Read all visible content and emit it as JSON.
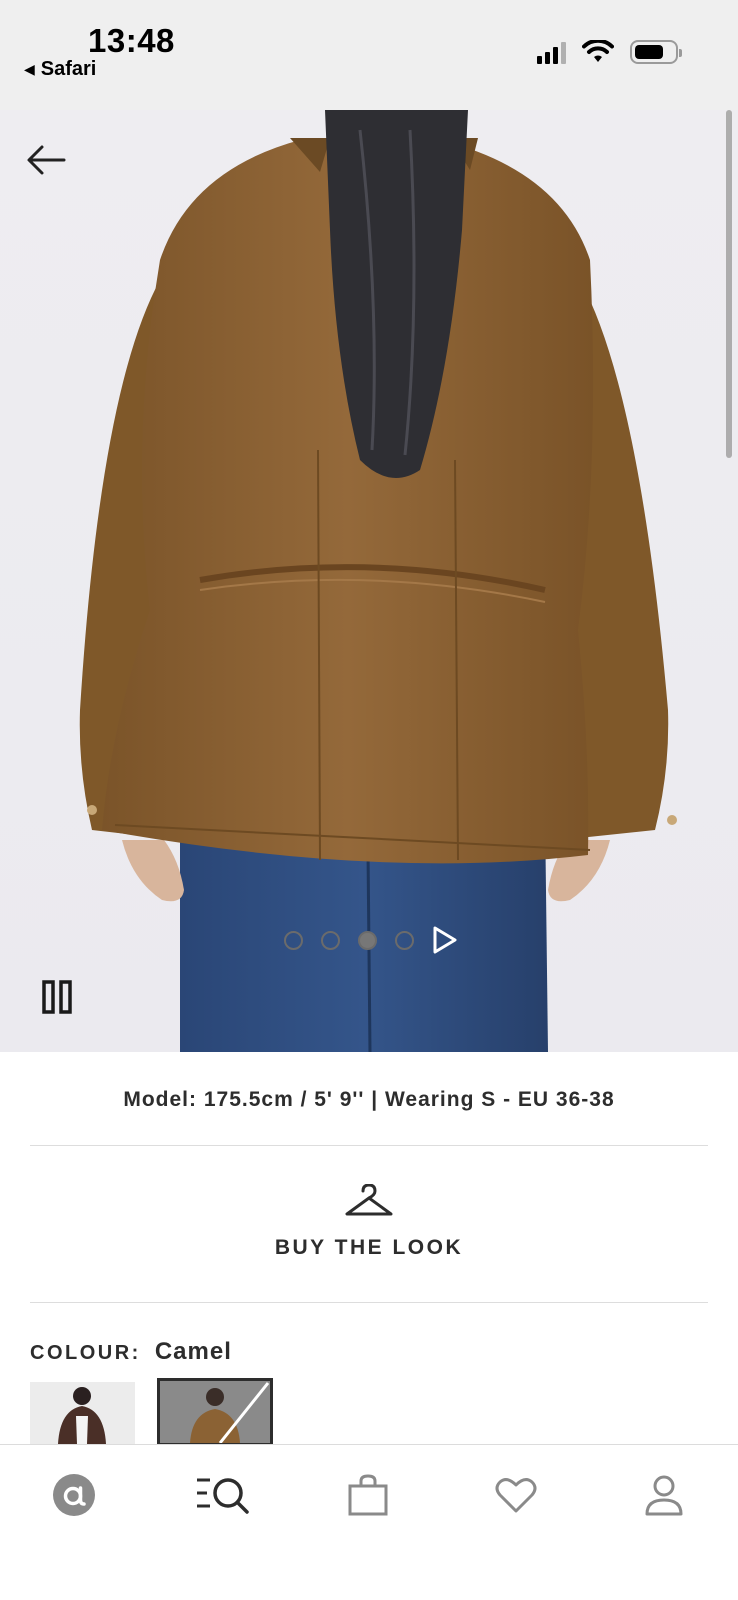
{
  "status_bar": {
    "time": "13:48",
    "back_app": "Safari",
    "back_indicator": "◀"
  },
  "gallery": {
    "image_count": 4,
    "active_index": 2,
    "icons": [
      "back-arrow-icon",
      "pause-icon",
      "play-icon"
    ]
  },
  "product": {
    "model_info": "Model: 175.5cm / 5' 9'' | Wearing S - EU 36-38",
    "buy_the_look": "BUY THE LOOK",
    "colour_label": "COLOUR:",
    "colour_value": "Camel"
  },
  "bottom_nav": {
    "items": [
      "home",
      "search",
      "bag",
      "saved",
      "account"
    ]
  },
  "colors": {
    "jacket": "#8b6234",
    "text": "#2d2d2d",
    "denim": "#2e4a78"
  }
}
